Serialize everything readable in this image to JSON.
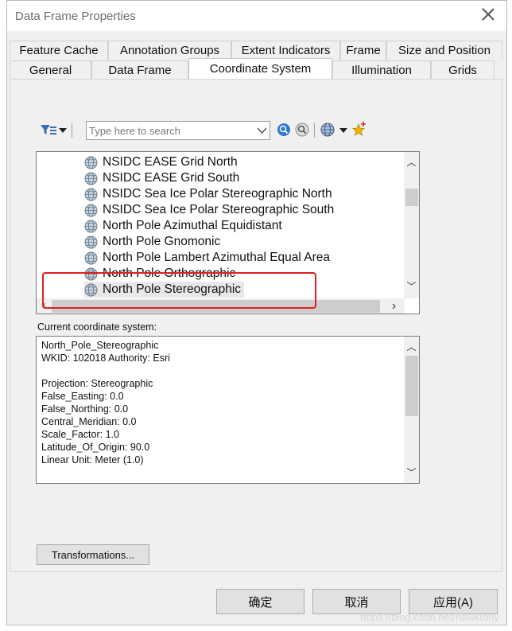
{
  "window": {
    "title": "Data Frame Properties"
  },
  "tabs_row1": [
    {
      "label": "Feature Cache",
      "w": 124
    },
    {
      "label": "Annotation Groups",
      "w": 155
    },
    {
      "label": "Extent Indicators",
      "w": 137
    },
    {
      "label": "Frame",
      "w": 58
    },
    {
      "label": "Size and Position",
      "w": 146
    }
  ],
  "tabs_row2": [
    {
      "label": "General"
    },
    {
      "label": "Data Frame"
    },
    {
      "label": "Coordinate System"
    },
    {
      "label": "Illumination"
    },
    {
      "label": "Grids"
    }
  ],
  "active_tab": "Coordinate System",
  "search": {
    "placeholder": "Type here to search"
  },
  "tree": {
    "items": [
      "NSIDC EASE Grid North",
      "NSIDC EASE Grid South",
      "NSIDC Sea Ice Polar Stereographic North",
      "NSIDC Sea Ice Polar Stereographic South",
      "North Pole Azimuthal Equidistant",
      "North Pole Gnomonic",
      "North Pole Lambert Azimuthal Equal Area",
      "North Pole Orthographic",
      "North Pole Stereographic"
    ],
    "selected": "North Pole Stereographic"
  },
  "current": {
    "label": "Current coordinate system:",
    "lines": [
      "North_Pole_Stereographic",
      "WKID: 102018 Authority: Esri",
      "",
      "Projection: Stereographic",
      "False_Easting: 0.0",
      "False_Northing: 0.0",
      "Central_Meridian: 0.0",
      "Scale_Factor: 1.0",
      "Latitude_Of_Origin: 90.0",
      "Linear Unit: Meter (1.0)"
    ]
  },
  "buttons": {
    "transformations": "Transformations...",
    "ok": "确定",
    "cancel": "取消",
    "apply": "应用(A)"
  },
  "watermark": "https://blog.csdn.net/hawktony",
  "colors": {
    "highlight": "#e02020",
    "panel": "#f0f0f0"
  }
}
